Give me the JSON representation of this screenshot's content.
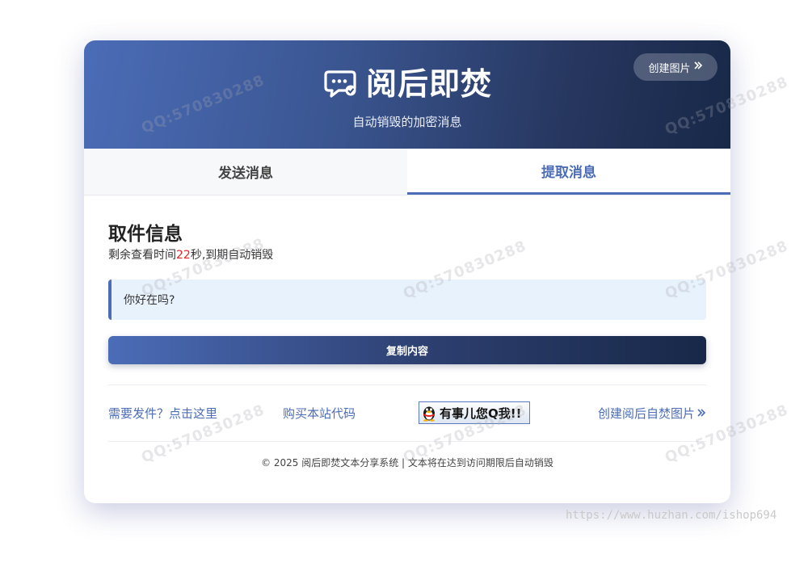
{
  "header": {
    "title": "阅后即焚",
    "subtitle": "自动销毁的加密消息",
    "create_button": "创建图片",
    "brand_icon": "chat-bubble-icon"
  },
  "tabs": [
    {
      "label": "发送消息",
      "active": false
    },
    {
      "label": "提取消息",
      "active": true
    }
  ],
  "pickup": {
    "title": "取件信息",
    "remain_prefix": "剩余查看时间",
    "remain_seconds": "22",
    "remain_suffix": "秒,到期自动销毁",
    "message": "你好在吗?",
    "copy_button": "复制内容"
  },
  "links": {
    "send_file": "需要发件？点击这里",
    "buy_code": "购买本站代码",
    "qq_badge": "有事儿您Q我!!",
    "create_image": "创建阅后自焚图片"
  },
  "footer": {
    "text": "© 2025 阅后即焚文本分享系统 | 文本将在达到访问期限后自动销毁"
  },
  "watermark": {
    "text": "QQ:570830288",
    "site_url": "https://www.huzhan.com/ishop694"
  },
  "colors": {
    "accent": "#4b6cb7",
    "dark": "#182848",
    "message_bg": "#e8f2fd",
    "countdown": "#e02424"
  }
}
